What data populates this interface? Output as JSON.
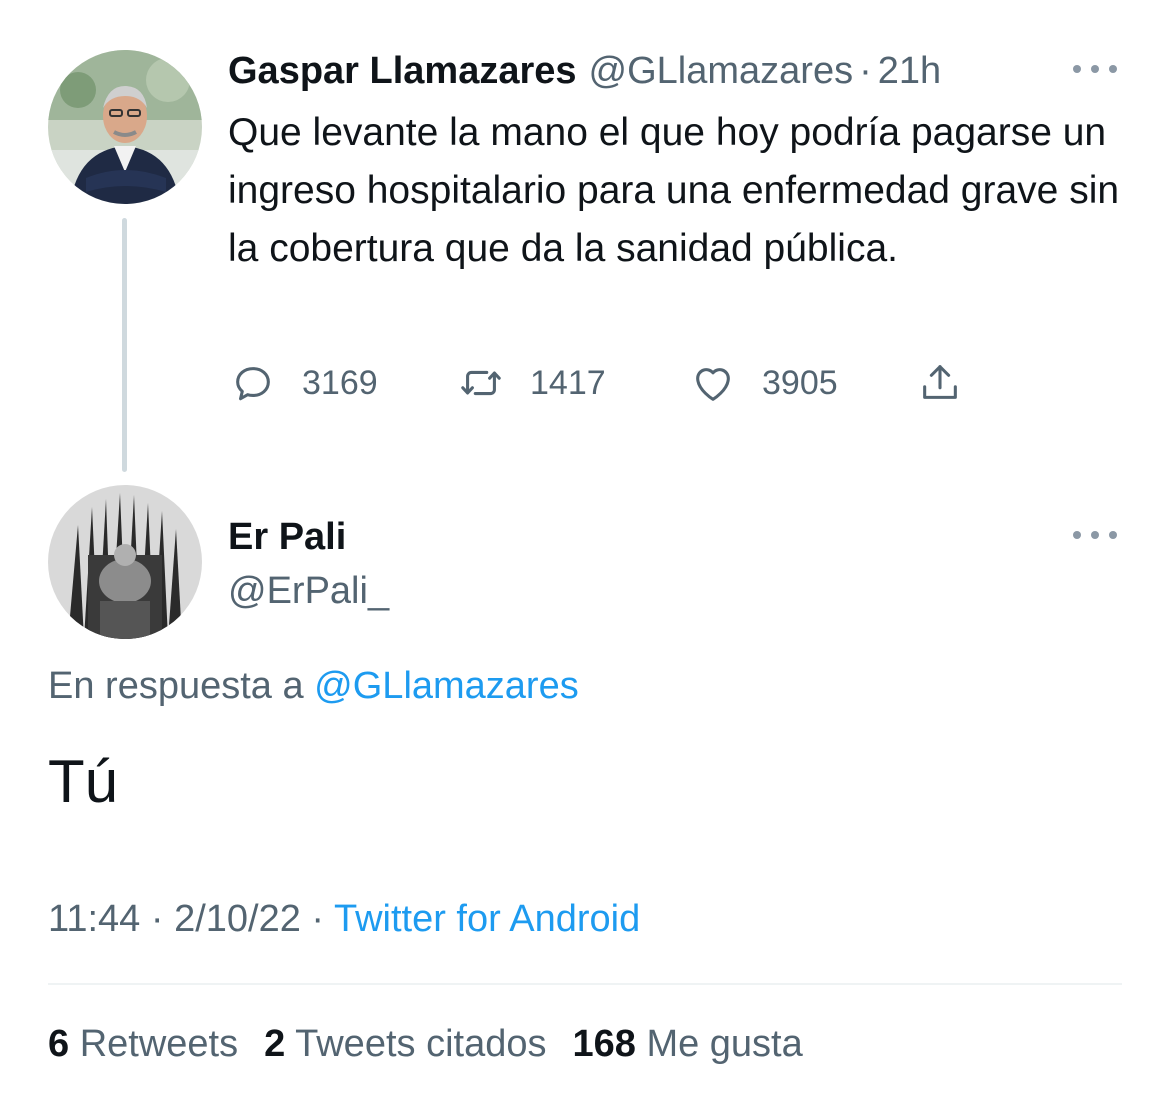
{
  "quoted_tweet": {
    "author_name": "Gaspar Llamazares",
    "handle": "@GLlamazares",
    "separator": "·",
    "time": "21h",
    "text": "Que levante la mano el que hoy podría pagarse un ingreso hospitalario para una enfermedad grave sin la cobertura que da la sanidad pública.",
    "actions": {
      "replies": "3169",
      "retweets": "1417",
      "likes": "3905"
    },
    "icons": [
      "reply-icon",
      "retweet-icon",
      "like-icon",
      "share-icon",
      "more-icon"
    ]
  },
  "reply_tweet": {
    "author_name": "Er Pali",
    "handle": "@ErPali_",
    "in_reply_prefix": "En respuesta a",
    "in_reply_handle": "@GLlamazares",
    "text": "Tú",
    "time": "11:44",
    "date": "2/10/22",
    "separator": "·",
    "source": "Twitter for Android"
  },
  "stats": {
    "retweets_count": "6",
    "retweets_label": "Retweets",
    "quotes_count": "2",
    "quotes_label": "Tweets citados",
    "likes_count": "168",
    "likes_label": "Me gusta"
  },
  "colors": {
    "text": "#0f1419",
    "muted": "#536471",
    "link": "#1d9bf0",
    "thread_line": "#cfd9de",
    "divider": "#eff3f4"
  }
}
